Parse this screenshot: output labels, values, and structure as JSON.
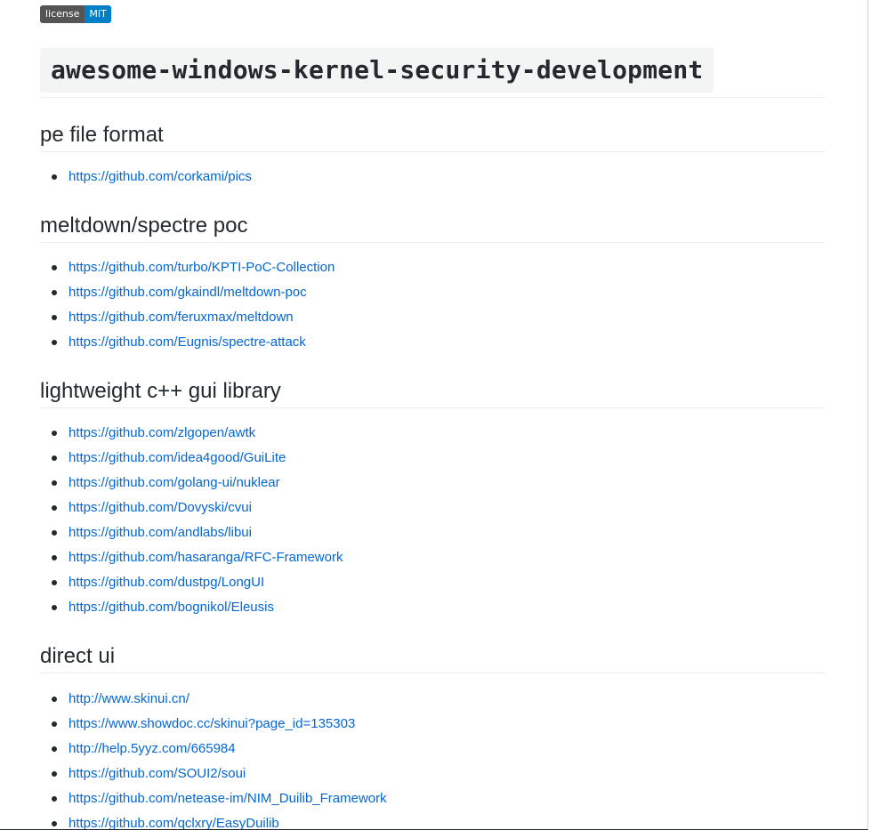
{
  "badge": {
    "left": "license",
    "right": "MIT"
  },
  "title": "awesome-windows-kernel-security-development",
  "sections": [
    {
      "heading": "pe file format",
      "links": [
        "https://github.com/corkami/pics"
      ]
    },
    {
      "heading": "meltdown/spectre poc",
      "links": [
        "https://github.com/turbo/KPTI-PoC-Collection",
        "https://github.com/gkaindl/meltdown-poc",
        "https://github.com/feruxmax/meltdown",
        "https://github.com/Eugnis/spectre-attack"
      ]
    },
    {
      "heading": "lightweight c++ gui library",
      "links": [
        "https://github.com/zlgopen/awtk",
        "https://github.com/idea4good/GuiLite",
        "https://github.com/golang-ui/nuklear",
        "https://github.com/Dovyski/cvui",
        "https://github.com/andlabs/libui",
        "https://github.com/hasaranga/RFC-Framework",
        "https://github.com/dustpg/LongUI",
        "https://github.com/bognikol/Eleusis"
      ]
    },
    {
      "heading": "direct ui",
      "links": [
        "http://www.skinui.cn/",
        "https://www.showdoc.cc/skinui?page_id=135303",
        "http://help.5yyz.com/665984",
        "https://github.com/SOUI2/soui",
        "https://github.com/netease-im/NIM_Duilib_Framework",
        "https://github.com/qclxry/EasyDuilib"
      ]
    }
  ]
}
